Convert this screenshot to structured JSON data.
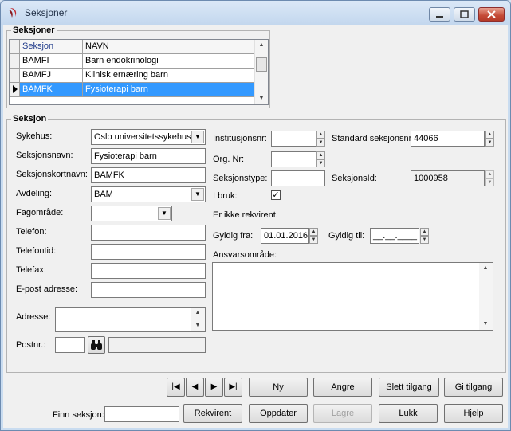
{
  "window": {
    "title": "Seksjoner"
  },
  "grid_group": {
    "title": "Seksjoner",
    "columns": [
      "Seksjon",
      "NAVN"
    ],
    "rows": [
      {
        "seksjon": "BAMFI",
        "navn": "Barn endokrinologi",
        "selected": false
      },
      {
        "seksjon": "BAMFJ",
        "navn": "Klinisk ernæring  barn",
        "selected": false
      },
      {
        "seksjon": "BAMFK",
        "navn": "Fysioterapi barn",
        "selected": true
      }
    ]
  },
  "form": {
    "title": "Seksjon",
    "sykehus": {
      "label": "Sykehus:",
      "value": "Oslo universitetssykehus"
    },
    "seksjonsnavn": {
      "label": "Seksjonsnavn:",
      "value": "Fysioterapi barn"
    },
    "seksjonskortnavn": {
      "label": "Seksjonskortnavn:",
      "value": "BAMFK"
    },
    "avdeling": {
      "label": "Avdeling:",
      "value": "BAM"
    },
    "fagomrade": {
      "label": "Fagområde:",
      "value": ""
    },
    "telefon": {
      "label": "Telefon:",
      "value": ""
    },
    "telefontid": {
      "label": "Telefontid:",
      "value": ""
    },
    "telefax": {
      "label": "Telefax:",
      "value": ""
    },
    "epost": {
      "label": "E-post adresse:",
      "value": ""
    },
    "adresse": {
      "label": "Adresse:",
      "value": ""
    },
    "postnr": {
      "label": "Postnr.:",
      "value": ""
    },
    "institusjonsnr": {
      "label": "Institusjonsnr:",
      "value": ""
    },
    "standard_seksjonsnr": {
      "label": "Standard seksjonsnr:",
      "value": "44066"
    },
    "org_nr": {
      "label": "Org. Nr:",
      "value": ""
    },
    "seksjonstype": {
      "label": "Seksjonstype:",
      "value": ""
    },
    "seksjonsid": {
      "label": "SeksjonsId:",
      "value": "1000958"
    },
    "i_bruk": {
      "label": "I bruk:",
      "checked": true,
      "mark": "✓"
    },
    "rekvirent_status": "Er ikke rekvirent.",
    "gyldig_fra": {
      "label": "Gyldig fra:",
      "value": "01.01.2016"
    },
    "gyldig_til": {
      "label": "Gyldig til:",
      "value": "__.__.____"
    },
    "ansvarsomrade": {
      "label": "Ansvarsområde:",
      "value": ""
    }
  },
  "nav": {
    "first": "|◀",
    "prev": "◀",
    "next": "▶",
    "last": "▶|"
  },
  "buttons": {
    "ny": "Ny",
    "angre": "Angre",
    "slett_tilgang": "Slett tilgang",
    "gi_tilgang": "Gi tilgang",
    "rekvirent": "Rekvirent",
    "oppdater": "Oppdater",
    "lagre": "Lagre",
    "lukk": "Lukk",
    "hjelp": "Hjelp"
  },
  "finn": {
    "label": "Finn seksjon:",
    "value": ""
  }
}
